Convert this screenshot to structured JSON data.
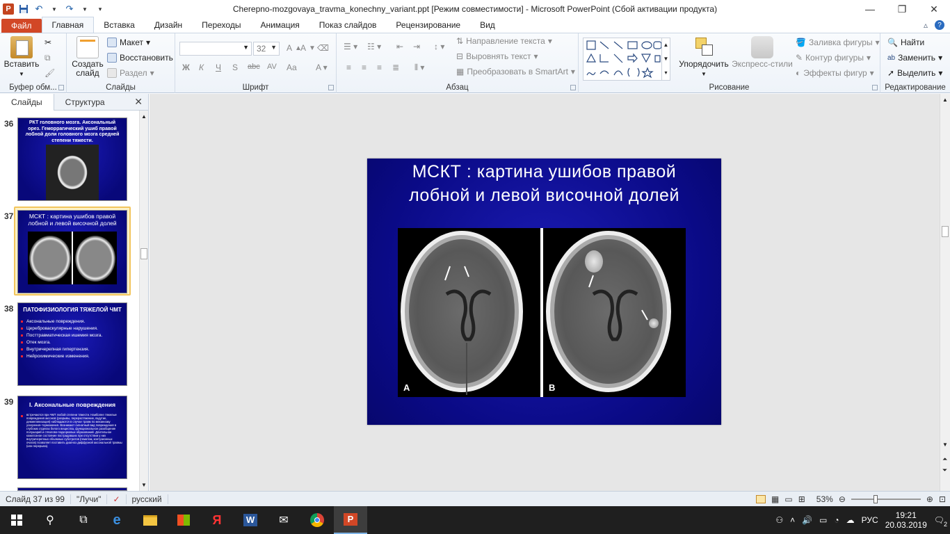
{
  "window": {
    "title": "Cherepno-mozgovaya_travma_konechny_variant.ppt [Режим совместимости]  -  Microsoft PowerPoint (Сбой активации продукта)"
  },
  "ribbon_tabs": [
    "Файл",
    "Главная",
    "Вставка",
    "Дизайн",
    "Переходы",
    "Анимация",
    "Показ слайдов",
    "Рецензирование",
    "Вид"
  ],
  "ribbon": {
    "clipboard": {
      "paste": "Вставить",
      "label": "Буфер обм..."
    },
    "slides": {
      "new_slide": "Создать слайд",
      "layout": "Макет",
      "reset": "Восстановить",
      "section": "Раздел",
      "label": "Слайды"
    },
    "font": {
      "font_name": "",
      "font_size": "32",
      "bold": "Ж",
      "italic": "К",
      "underline": "Ч",
      "shadow": "S",
      "strike": "abc",
      "spacing": "AV",
      "case": "Aa",
      "label": "Шрифт"
    },
    "paragraph": {
      "text_direction": "Направление текста",
      "align_text": "Выровнять текст",
      "smartart": "Преобразовать в SmartArt",
      "label": "Абзац"
    },
    "drawing": {
      "arrange": "Упорядочить",
      "quick_styles": "Экспресс-стили",
      "fill": "Заливка фигуры",
      "outline": "Контур фигуры",
      "effects": "Эффекты фигур",
      "label": "Рисование"
    },
    "editing": {
      "find": "Найти",
      "replace": "Заменить",
      "select": "Выделить",
      "label": "Редактирование"
    }
  },
  "left_panel": {
    "tabs": [
      "Слайды",
      "Структура"
    ],
    "thumbnails": [
      {
        "num": "36",
        "title": "РКТ головного  мозга. Аксональный орез. Геморрагический ушиб  правой лобной доли головного мозга средней степени тяжести."
      },
      {
        "num": "37",
        "title": "МСКТ : картина ушибов правой лобной и левой височной долей"
      },
      {
        "num": "38",
        "title": "ПАТОФИЗИОЛОГИЯ ТЯЖЕЛОЙ ЧМТ",
        "bullets": [
          "Аксональные повреждения.",
          "Цереброваскулярные нарушения.",
          "Посттравматическая ишемия мозга.",
          "Отек мозга.",
          "Внутричерепная гипертензия.",
          "Нейрохимические изменения."
        ]
      },
      {
        "num": "39",
        "title": "I. Аксональные повреждения",
        "body": "встречаются  при  ЧМТ любой степени  тяжести. Наиболее тяжелые  повреждения аксонов (разрывы, перерастяжение, вздутие, демиелинизация) наблюдаются в случае травм по механизму ускорения–торможения. Возникают  сигнатный вид повреждения в глубоких отделах белого вещества, функциональное разобщение полушарий и стволово-подкорковых образований. Длительное коматозное  состояние пострадавших при отсутствии у них внутричерепных объемных субстратов (гематом, контузионных  очагов) позволяет поставить диагноз диффузной аксональной травмы (или перерыва)."
      }
    ]
  },
  "slide": {
    "title_line1": "МСКТ  : картина  ушибов  правой",
    "title_line2": "лобной  и левой  височной  долей",
    "image_labels": [
      "A",
      "B"
    ]
  },
  "status": {
    "slide_info": "Слайд 37 из 99",
    "theme": "\"Лучи\"",
    "language": "русский",
    "zoom": "53%"
  },
  "taskbar": {
    "lang": "РУС",
    "time": "19:21",
    "date": "20.03.2019",
    "notifications": "2"
  },
  "colors": {
    "file_tab": "#d24726",
    "slide_bg": "#0a0a86",
    "selection": "#f2c55c"
  }
}
